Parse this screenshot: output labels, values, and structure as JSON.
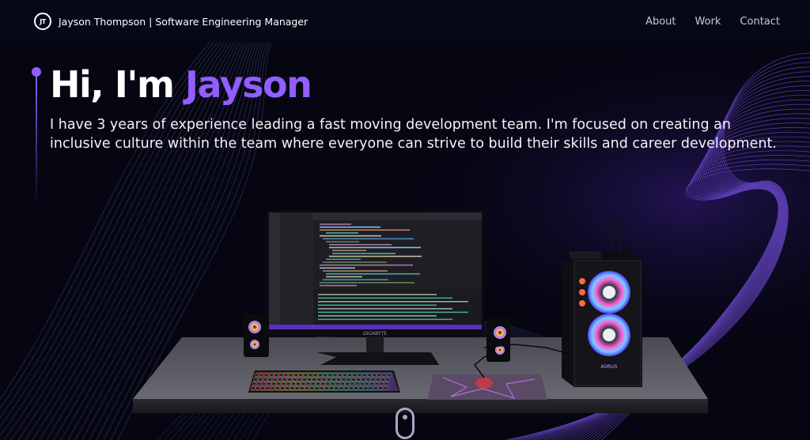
{
  "navbar": {
    "logo_mark": "JT",
    "brand": "Jayson Thompson | Software Engineering Manager",
    "links": [
      "About",
      "Work",
      "Contact"
    ]
  },
  "hero": {
    "greeting": "Hi, I'm ",
    "name": "Jayson",
    "subtitle": "I have 3 years of experience leading a fast moving development team. I'm focused on creating an inclusive culture within the team where everyone can strive to build their skills and career development."
  },
  "scene": {
    "monitor_brand": "GIGABYTE",
    "case_brand": "AORUS"
  },
  "colors": {
    "background": "#050816",
    "accent": "#915eff",
    "text": "#ffffff",
    "nav_text": "#c8c8d4"
  }
}
